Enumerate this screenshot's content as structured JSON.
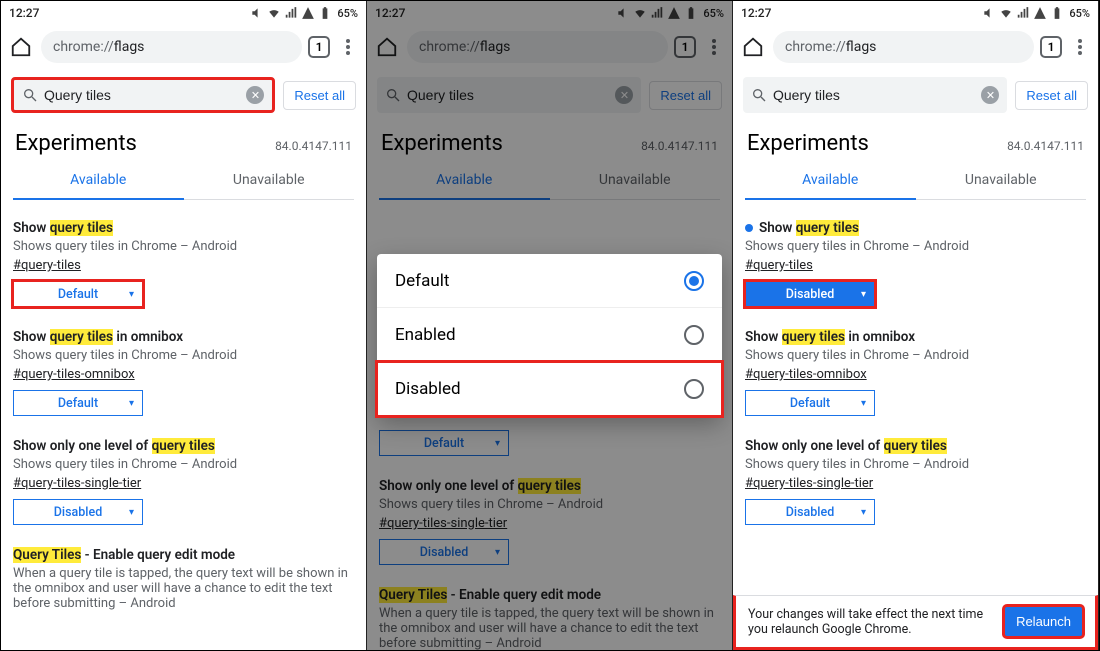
{
  "statusbar": {
    "time": "12:27",
    "battery": "65%"
  },
  "urlbar": {
    "scheme": "chrome://",
    "path": "flags",
    "tabcount": "1"
  },
  "search": {
    "value": "Query tiles",
    "reset": "Reset all"
  },
  "header": {
    "title": "Experiments",
    "version": "84.0.4147.111"
  },
  "tabs": {
    "available": "Available",
    "unavailable": "Unavailable"
  },
  "flags": {
    "f1": {
      "title_pre": "Show ",
      "title_hi": "query tiles",
      "title_post": "",
      "desc": "Shows query tiles in Chrome – Android",
      "anchor": "#query-tiles",
      "ddl_default": "Default",
      "ddl_disabled": "Disabled"
    },
    "f2": {
      "title_pre": "Show ",
      "title_hi": "query tiles",
      "title_post": " in omnibox",
      "desc": "Shows query tiles in Chrome – Android",
      "anchor": "#query-tiles-omnibox",
      "ddl": "Default"
    },
    "f3": {
      "title_pre": "Show only one level of ",
      "title_hi": "query tiles",
      "title_post": "",
      "desc": "Shows query tiles in Chrome – Android",
      "anchor": "#query-tiles-single-tier",
      "ddl": "Disabled"
    },
    "f4": {
      "title_hi": "Query Tiles",
      "title_post": " - Enable query edit mode",
      "desc": "When a query tile is tapped, the query text will be shown in the omnibox and user will have a chance to edit the text before submitting – Android"
    }
  },
  "popup": {
    "opt1": "Default",
    "opt2": "Enabled",
    "opt3": "Disabled"
  },
  "relaunch": {
    "msg": "Your changes will take effect the next time you relaunch Google Chrome.",
    "btn": "Relaunch"
  }
}
